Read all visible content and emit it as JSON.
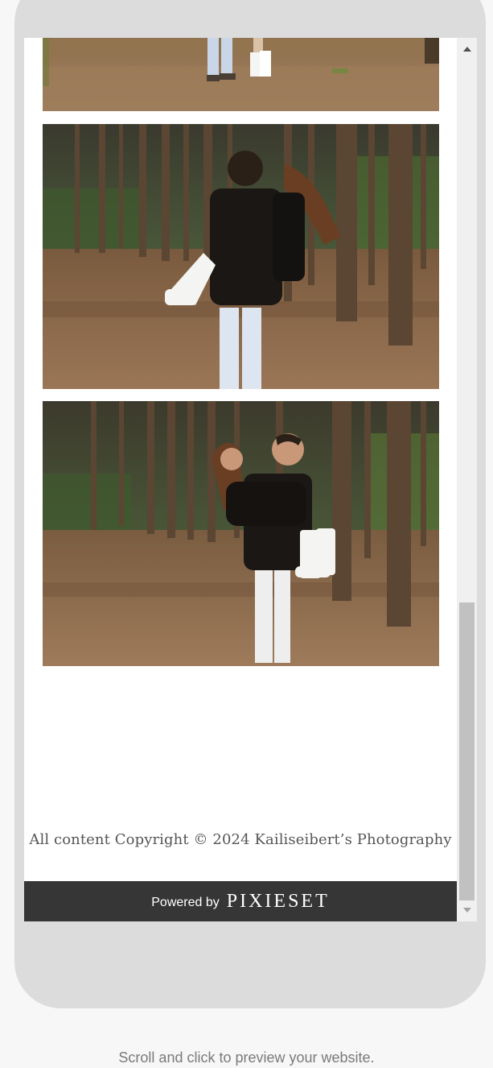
{
  "gallery": {
    "photos": [
      {
        "alt": "couple standing, legs and white boots"
      },
      {
        "alt": "man carrying woman in forest"
      },
      {
        "alt": "man carrying woman smiling in forest"
      }
    ]
  },
  "footer": {
    "copyright": "All content Copyright © 2024 Kailiseibert’s Photography",
    "powered_by_label": "Powered by",
    "powered_by_brand": "PIXIESET"
  },
  "preview_hint": "Scroll and click to preview your website."
}
